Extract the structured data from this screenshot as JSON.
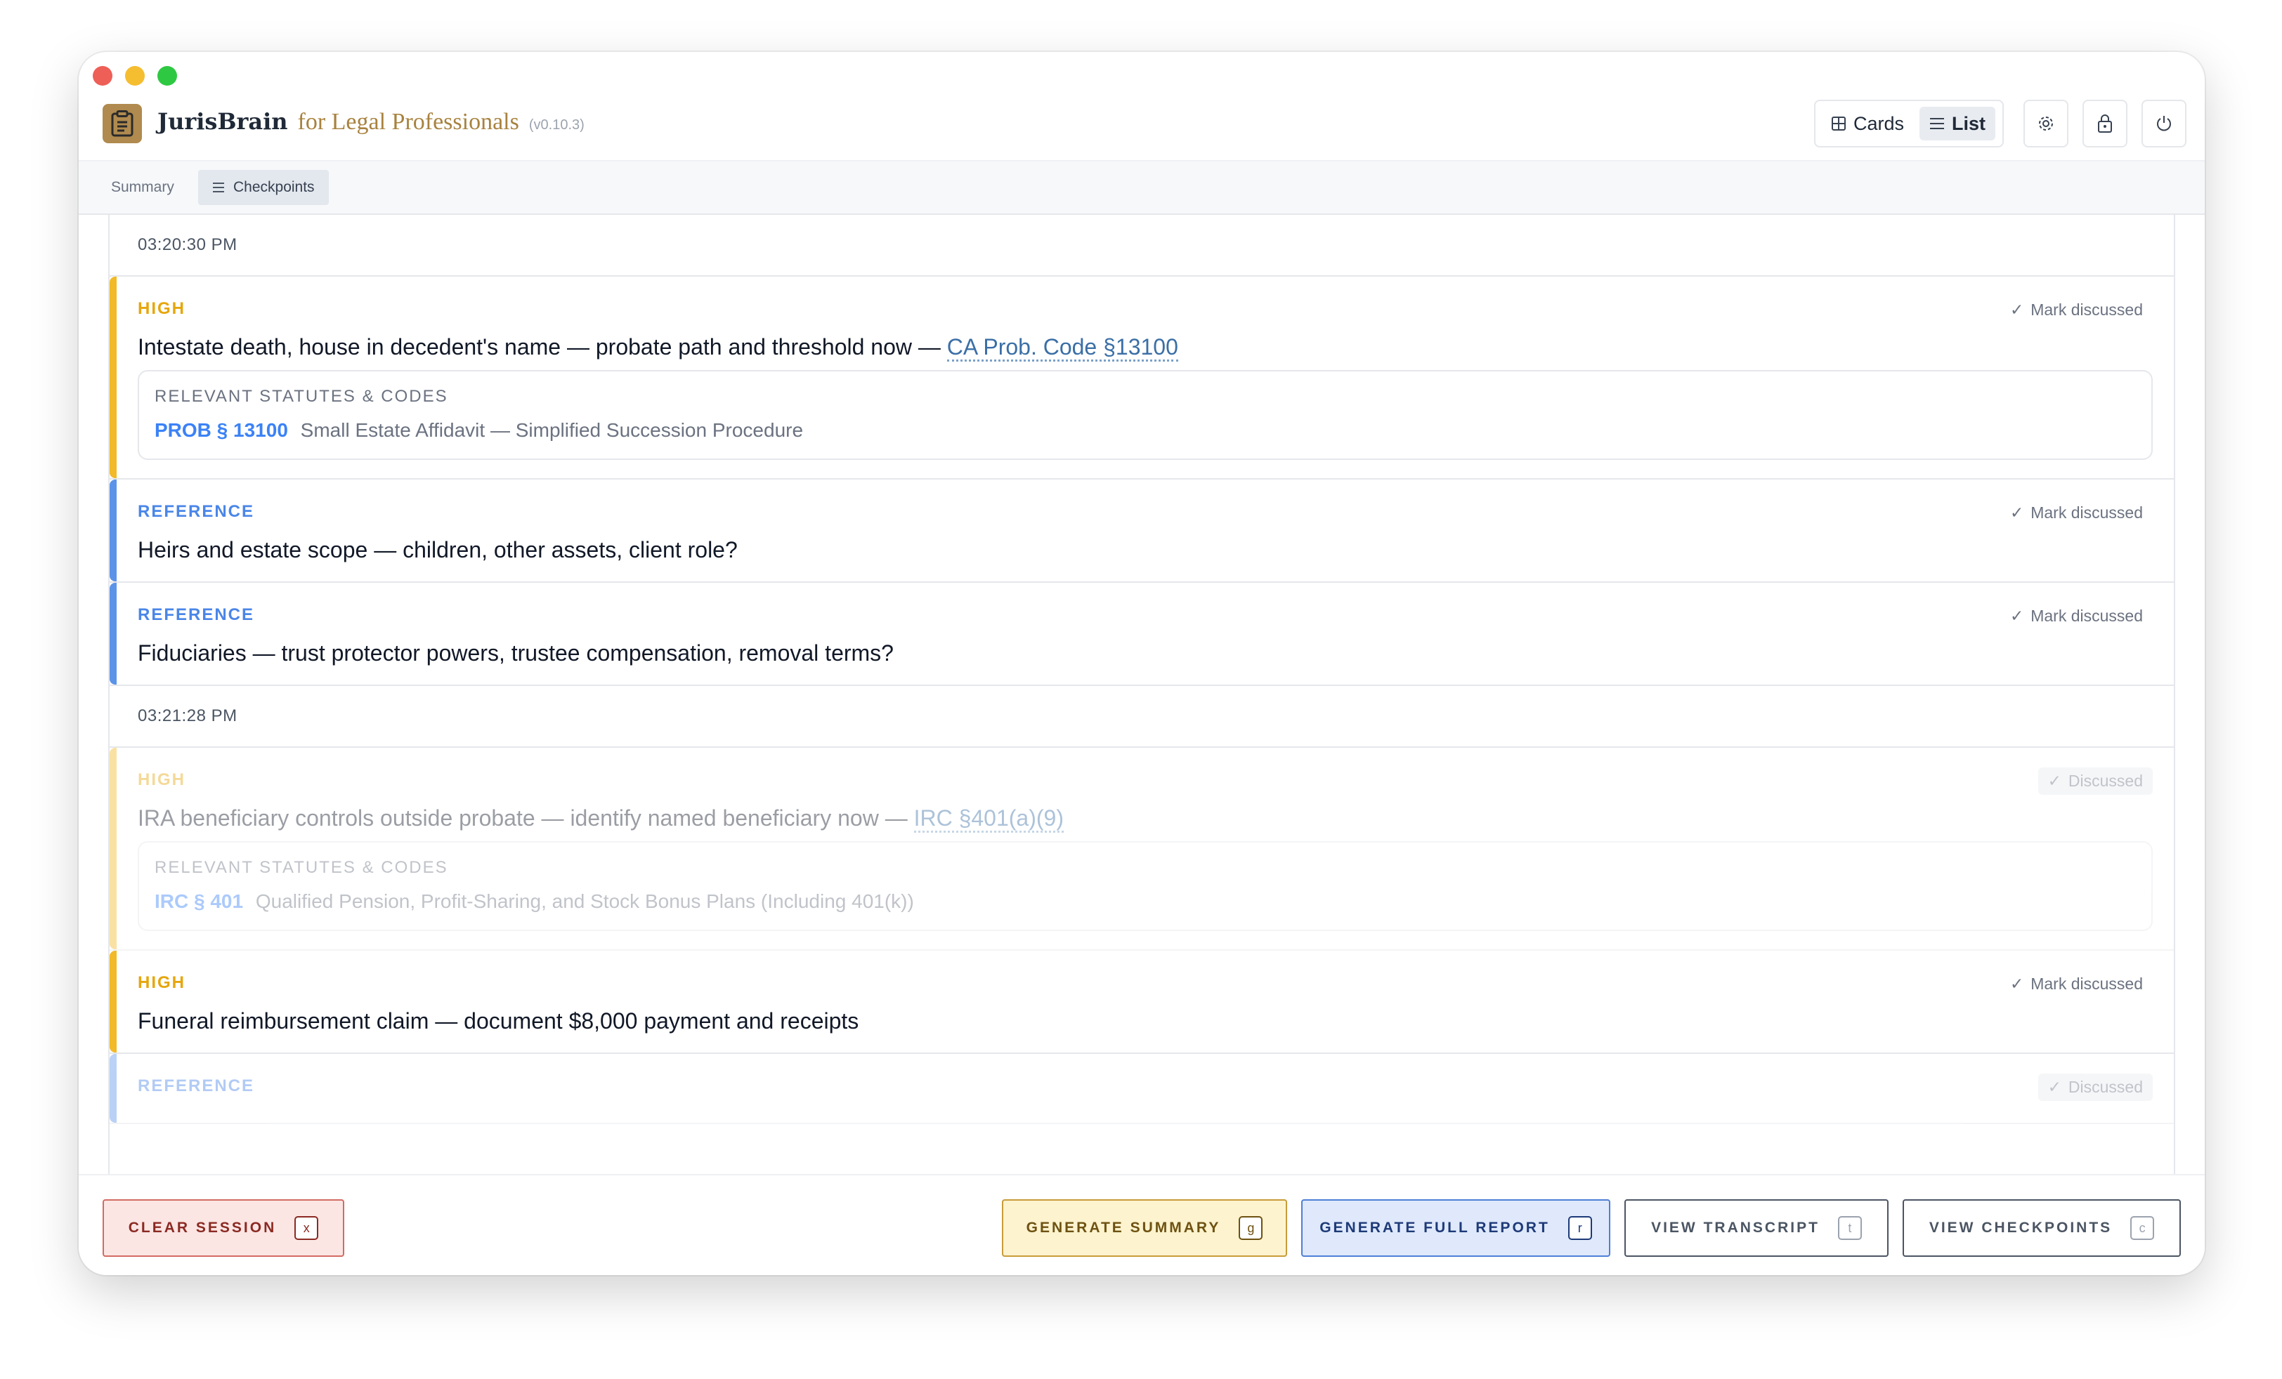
{
  "app": {
    "name": "JurisBrain",
    "subtitle": "for Legal Professionals",
    "version": "(v0.10.3)"
  },
  "header": {
    "view_cards": "Cards",
    "view_list": "List",
    "active_view": "List"
  },
  "tabs": [
    {
      "label": "Summary",
      "active": false
    },
    {
      "label": "Checkpoints",
      "active": true
    }
  ],
  "groups": [
    {
      "time": "03:20:30 PM",
      "items": [
        {
          "priority": "HIGH",
          "action": "Mark discussed",
          "title": "Intestate death, house in decedent's name — probate path and threshold now — ",
          "citation": "CA Prob. Code §13100",
          "statutes_heading": "RELEVANT STATUTES & CODES",
          "statute_code": "PROB § 13100",
          "statute_desc": "Small Estate Affidavit — Simplified Succession Procedure"
        },
        {
          "priority": "REFERENCE",
          "action": "Mark discussed",
          "title": "Heirs and estate scope — children, other assets, client role?"
        },
        {
          "priority": "REFERENCE",
          "action": "Mark discussed",
          "title": "Fiduciaries — trust protector powers, trustee compensation, removal terms?"
        }
      ]
    },
    {
      "time": "03:21:28 PM",
      "items": [
        {
          "priority": "HIGH",
          "action": "Discussed",
          "title": "IRA beneficiary controls outside probate — identify named beneficiary now — ",
          "citation": "IRC §401(a)(9)",
          "statutes_heading": "RELEVANT STATUTES & CODES",
          "statute_code": "IRC § 401",
          "statute_desc": "Qualified Pension, Profit-Sharing, and Stock Bonus Plans (Including 401(k))"
        },
        {
          "priority": "HIGH",
          "action": "Mark discussed",
          "title": "Funeral reimbursement claim — document $8,000 payment and receipts"
        },
        {
          "priority": "REFERENCE",
          "action": "Discussed"
        }
      ]
    }
  ],
  "footer": {
    "clear": {
      "label": "CLEAR SESSION",
      "key": "x"
    },
    "generate_summary": {
      "label": "GENERATE SUMMARY",
      "key": "g"
    },
    "generate_report": {
      "label": "GENERATE FULL REPORT",
      "key": "r"
    },
    "view_transcript": {
      "label": "VIEW TRANSCRIPT",
      "key": "t"
    },
    "view_checkpoints": {
      "label": "VIEW CHECKPOINTS",
      "key": "c"
    }
  },
  "colors": {
    "high": "#f2b928",
    "reference": "#5b93e8",
    "brand": "#b08a4e"
  }
}
